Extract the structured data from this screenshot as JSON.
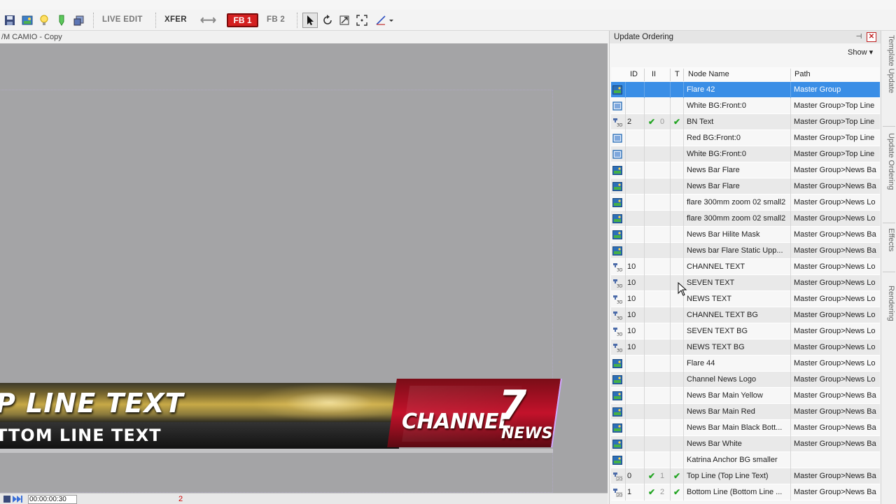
{
  "toolbar": {
    "live_edit": "LIVE EDIT",
    "xfer": "XFER",
    "fb1": "FB 1",
    "fb2": "FB 2",
    "arrows_glyph": "⟷",
    "icons": [
      "save-icon",
      "image-icon",
      "lightbulb-icon",
      "marker-icon",
      "layers-icon",
      "pointer-icon",
      "rotate-icon",
      "scale-icon",
      "fit-icon",
      "curve-icon"
    ]
  },
  "canvas": {
    "title": "/M CAMIO - Copy",
    "lower_third": {
      "line1": "P LINE TEXT",
      "line2": "TTOM LINE TEXT",
      "brand_channel": "CHANNEL",
      "brand_number": "7",
      "brand_news": "NEWS"
    }
  },
  "status": {
    "timecode": "00:00:00:30",
    "counter": "2"
  },
  "panel": {
    "title": "Update Ordering",
    "pin_glyph": "⊣",
    "close_glyph": "✕",
    "show_label": "Show ▾",
    "columns": {
      "id": "ID",
      "ii": "II",
      "t": "T",
      "node_name": "Node Name",
      "path": "Path"
    },
    "rows": [
      {
        "icon": "image",
        "id": "",
        "c1": "",
        "c2": "",
        "ct": "",
        "name": "Flare 42",
        "path": "Master Group",
        "selected": true
      },
      {
        "icon": "frame",
        "id": "",
        "c1": "",
        "c2": "",
        "ct": "",
        "name": "White BG:Front:0",
        "path": "Master Group>Top Line"
      },
      {
        "icon": "text3d",
        "id": "2",
        "c1": "✔",
        "c2": "0",
        "ct": "✔",
        "name": "BN Text",
        "path": "Master Group>Top Line"
      },
      {
        "icon": "frame",
        "id": "",
        "c1": "",
        "c2": "",
        "ct": "",
        "name": "Red BG:Front:0",
        "path": "Master Group>Top Line"
      },
      {
        "icon": "frame",
        "id": "",
        "c1": "",
        "c2": "",
        "ct": "",
        "name": "White BG:Front:0",
        "path": "Master Group>Top Line"
      },
      {
        "icon": "image",
        "id": "",
        "c1": "",
        "c2": "",
        "ct": "",
        "name": "News Bar Flare",
        "path": "Master Group>News Ba"
      },
      {
        "icon": "image",
        "id": "",
        "c1": "",
        "c2": "",
        "ct": "",
        "name": "News Bar Flare",
        "path": "Master Group>News Ba"
      },
      {
        "icon": "image",
        "id": "",
        "c1": "",
        "c2": "",
        "ct": "",
        "name": "flare 300mm zoom 02 small2",
        "path": "Master Group>News Lo"
      },
      {
        "icon": "image",
        "id": "",
        "c1": "",
        "c2": "",
        "ct": "",
        "name": "flare 300mm zoom 02 small2",
        "path": "Master Group>News Lo"
      },
      {
        "icon": "image",
        "id": "",
        "c1": "",
        "c2": "",
        "ct": "",
        "name": "News Bar Hilite Mask",
        "path": "Master Group>News Ba"
      },
      {
        "icon": "image",
        "id": "",
        "c1": "",
        "c2": "",
        "ct": "",
        "name": "News bar Flare Static Upp...",
        "path": "Master Group>News Ba"
      },
      {
        "icon": "text3d",
        "id": "10",
        "c1": "",
        "c2": "",
        "ct": "",
        "name": "CHANNEL TEXT",
        "path": "Master Group>News Lo"
      },
      {
        "icon": "text3d",
        "id": "10",
        "c1": "",
        "c2": "",
        "ct": "",
        "name": "SEVEN TEXT",
        "path": "Master Group>News Lo"
      },
      {
        "icon": "text3d",
        "id": "10",
        "c1": "",
        "c2": "",
        "ct": "",
        "name": "NEWS TEXT",
        "path": "Master Group>News Lo"
      },
      {
        "icon": "text3d",
        "id": "10",
        "c1": "",
        "c2": "",
        "ct": "",
        "name": "CHANNEL TEXT BG",
        "path": "Master Group>News Lo"
      },
      {
        "icon": "text3d",
        "id": "10",
        "c1": "",
        "c2": "",
        "ct": "",
        "name": "SEVEN TEXT BG",
        "path": "Master Group>News Lo"
      },
      {
        "icon": "text3d",
        "id": "10",
        "c1": "",
        "c2": "",
        "ct": "",
        "name": "NEWS TEXT BG",
        "path": "Master Group>News Lo"
      },
      {
        "icon": "image",
        "id": "",
        "c1": "",
        "c2": "",
        "ct": "",
        "name": "Flare 44",
        "path": "Master Group>News Lo"
      },
      {
        "icon": "image",
        "id": "",
        "c1": "",
        "c2": "",
        "ct": "",
        "name": "Channel News Logo",
        "path": "Master Group>News Lo"
      },
      {
        "icon": "image",
        "id": "",
        "c1": "",
        "c2": "",
        "ct": "",
        "name": "News Bar Main Yellow",
        "path": "Master Group>News Ba"
      },
      {
        "icon": "image",
        "id": "",
        "c1": "",
        "c2": "",
        "ct": "",
        "name": "News Bar Main Red",
        "path": "Master Group>News Ba"
      },
      {
        "icon": "image",
        "id": "",
        "c1": "",
        "c2": "",
        "ct": "",
        "name": "News Bar Main Black Bott...",
        "path": "Master Group>News Ba"
      },
      {
        "icon": "image",
        "id": "",
        "c1": "",
        "c2": "",
        "ct": "",
        "name": "News Bar White",
        "path": "Master Group>News Ba"
      },
      {
        "icon": "image",
        "id": "",
        "c1": "",
        "c2": "",
        "ct": "",
        "name": "Katrina Anchor BG smaller",
        "path": ""
      },
      {
        "icon": "text2d",
        "id": "0",
        "c1": "✔",
        "c2": "1",
        "ct": "✔",
        "name": "Top Line (Top Line Text)",
        "path": "Master Group>News Ba"
      },
      {
        "icon": "text2d",
        "id": "1",
        "c1": "✔",
        "c2": "2",
        "ct": "✔",
        "name": "Bottom Line (Bottom Line ...",
        "path": "Master Group>News Ba"
      }
    ]
  },
  "side_tabs": [
    "Template Update",
    "Update Ordering",
    "Effects",
    "Rendering"
  ],
  "colors": {
    "selection": "#3a8ee6",
    "check": "#24a524",
    "fb1_red": "#d42020"
  }
}
